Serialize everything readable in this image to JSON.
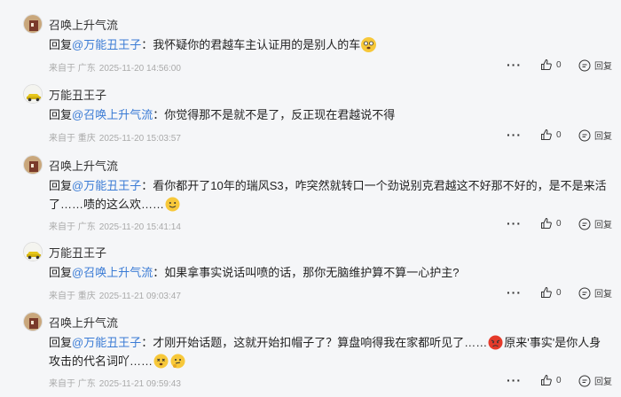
{
  "comments": [
    {
      "username": "召唤上升气流",
      "reply_prefix": "回复",
      "mention": "@万能丑王子",
      "colon": "：",
      "text": "我怀疑你的君越车主认证用的是别人的车",
      "text2": "",
      "location": "来自于 广东",
      "time": "2025-11-20 14:56:00",
      "likes": "0",
      "reply_label": "回复"
    },
    {
      "username": "万能丑王子",
      "reply_prefix": "回复",
      "mention": "@召唤上升气流",
      "colon": "：",
      "text": "你觉得那不是就不是了，反正现在君越说不得",
      "text2": "",
      "location": "来自于 重庆",
      "time": "2025-11-20 15:03:57",
      "likes": "0",
      "reply_label": "回复"
    },
    {
      "username": "召唤上升气流",
      "reply_prefix": "回复",
      "mention": "@万能丑王子",
      "colon": "：",
      "text": "看你都开了10年的瑞风S3，咋突然就转口一个劲说别克君越这不好那不好的，是不是来活了……啧的这么欢……",
      "text2": "",
      "location": "来自于 广东",
      "time": "2025-11-20 15:41:14",
      "likes": "0",
      "reply_label": "回复"
    },
    {
      "username": "万能丑王子",
      "reply_prefix": "回复",
      "mention": "@召唤上升气流",
      "colon": "：",
      "text": "如果拿事实说话叫喷的话，那你无脑维护算不算一心护主?",
      "text2": "",
      "location": "来自于 重庆",
      "time": "2025-11-21 09:03:47",
      "likes": "0",
      "reply_label": "回复"
    },
    {
      "username": "召唤上升气流",
      "reply_prefix": "回复",
      "mention": "@万能丑王子",
      "colon": "：",
      "text": "才刚开始话题，这就开始扣帽子了？算盘响得我在家都听见了……",
      "text2": "原来'事实'是你人身攻击的代名词吖……",
      "location": "来自于 广东",
      "time": "2025-11-21 09:59:43",
      "likes": "0",
      "reply_label": "回复"
    }
  ],
  "top_actions": {
    "likes": "0",
    "reply_label": "回复"
  },
  "icons": {
    "more": "more-dots-icon",
    "like": "thumbs-up-icon",
    "reply": "reply-bubble-icon"
  },
  "colors": {
    "mention": "#3a7bd5",
    "meta": "#aaaaaa",
    "background": "#f5f6f8"
  }
}
